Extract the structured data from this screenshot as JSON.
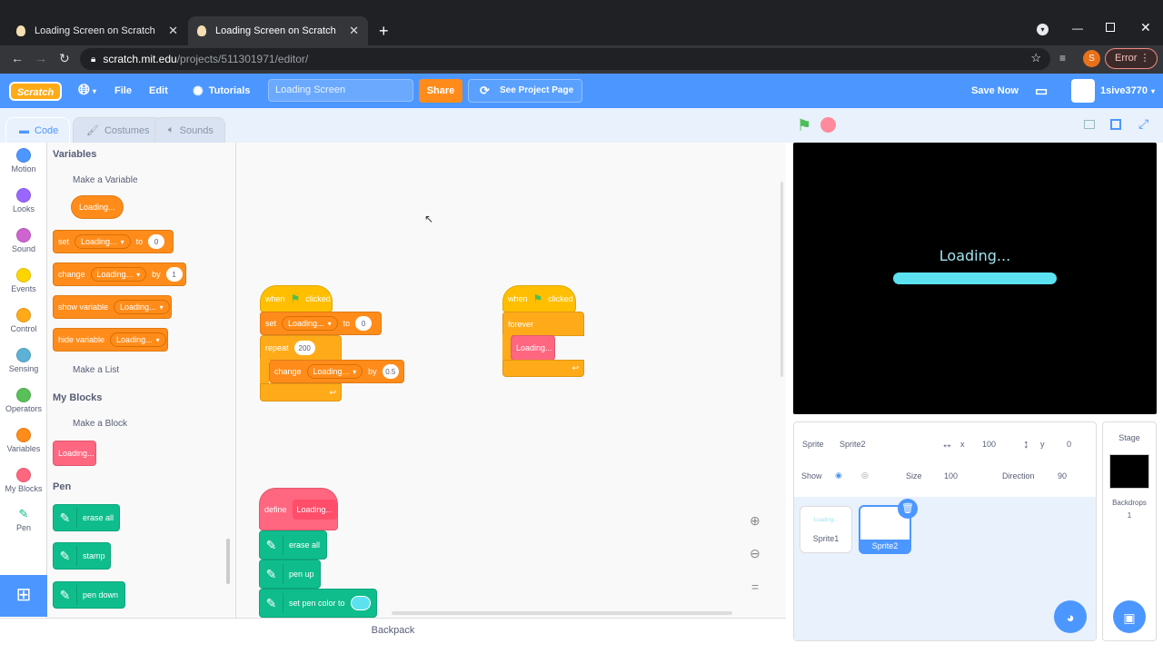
{
  "browser": {
    "tabs": [
      {
        "title": "Loading Screen on Scratch"
      },
      {
        "title": "Loading Screen on Scratch"
      }
    ],
    "new_tab": "+",
    "url_host": "scratch.mit.edu",
    "url_path": "/projects/511301971/editor/",
    "profile_initial": "S",
    "error_label": "Error"
  },
  "menubar": {
    "logo": "Scratch",
    "file": "File",
    "edit": "Edit",
    "tutorials": "Tutorials",
    "project_title": "Loading Screen",
    "share": "Share",
    "see_project": "See Project Page",
    "save_now": "Save Now",
    "username": "1sive3770"
  },
  "editor_tabs": {
    "code": "Code",
    "costumes": "Costumes",
    "sounds": "Sounds"
  },
  "categories": [
    {
      "label": "Motion",
      "color": "#4c97ff"
    },
    {
      "label": "Looks",
      "color": "#9966ff"
    },
    {
      "label": "Sound",
      "color": "#cf63cf"
    },
    {
      "label": "Events",
      "color": "#ffd500"
    },
    {
      "label": "Control",
      "color": "#ffab19"
    },
    {
      "label": "Sensing",
      "color": "#5cb1d6"
    },
    {
      "label": "Operators",
      "color": "#59c059"
    },
    {
      "label": "Variables",
      "color": "#ff8c1a"
    },
    {
      "label": "My Blocks",
      "color": "#ff6680"
    },
    {
      "label": "Pen",
      "color": "#0fbd8c"
    }
  ],
  "palette": {
    "variables_heading": "Variables",
    "make_variable": "Make a Variable",
    "var_reporter": "Loading...",
    "set_block": {
      "label": "set",
      "var": "Loading...",
      "to": "to",
      "value": "0"
    },
    "change_block": {
      "label": "change",
      "var": "Loading...",
      "by": "by",
      "value": "1"
    },
    "show_var": {
      "label": "show variable",
      "var": "Loading..."
    },
    "hide_var": {
      "label": "hide variable",
      "var": "Loading..."
    },
    "make_list": "Make a List",
    "myblocks_heading": "My Blocks",
    "make_block": "Make a Block",
    "custom_block": "Loading...",
    "pen_heading": "Pen",
    "erase_all": "erase all",
    "stamp": "stamp",
    "pen_down": "pen down"
  },
  "scripts": {
    "s1": {
      "hat": "when",
      "clicked": "clicked",
      "set": "set",
      "var": "Loading...",
      "to": "to",
      "set_value": "0",
      "repeat": "repeat",
      "repeat_value": "200",
      "change": "change",
      "by": "by",
      "change_value": "0.5"
    },
    "s2": {
      "hat": "when",
      "clicked": "clicked",
      "forever": "forever",
      "call": "Loading..."
    },
    "s3": {
      "define": "define",
      "call": "Loading...",
      "erase_all": "erase all",
      "pen_up": "pen up",
      "set_pen_color": "set pen color to"
    }
  },
  "zoom": {
    "equals": "="
  },
  "backpack": "Backpack",
  "stage": {
    "loading_text": "Loading..."
  },
  "sprite_info": {
    "sprite_label": "Sprite",
    "sprite_name": "Sprite2",
    "x_label": "x",
    "x_value": "100",
    "y_label": "y",
    "y_value": "0",
    "show_label": "Show",
    "size_label": "Size",
    "size_value": "100",
    "direction_label": "Direction",
    "direction_value": "90"
  },
  "sprites": [
    {
      "name": "Sprite1",
      "thumb_text": "Loading..."
    },
    {
      "name": "Sprite2"
    }
  ],
  "stage_pane": {
    "title": "Stage",
    "backdrops_label": "Backdrops",
    "backdrops_count": "1"
  }
}
